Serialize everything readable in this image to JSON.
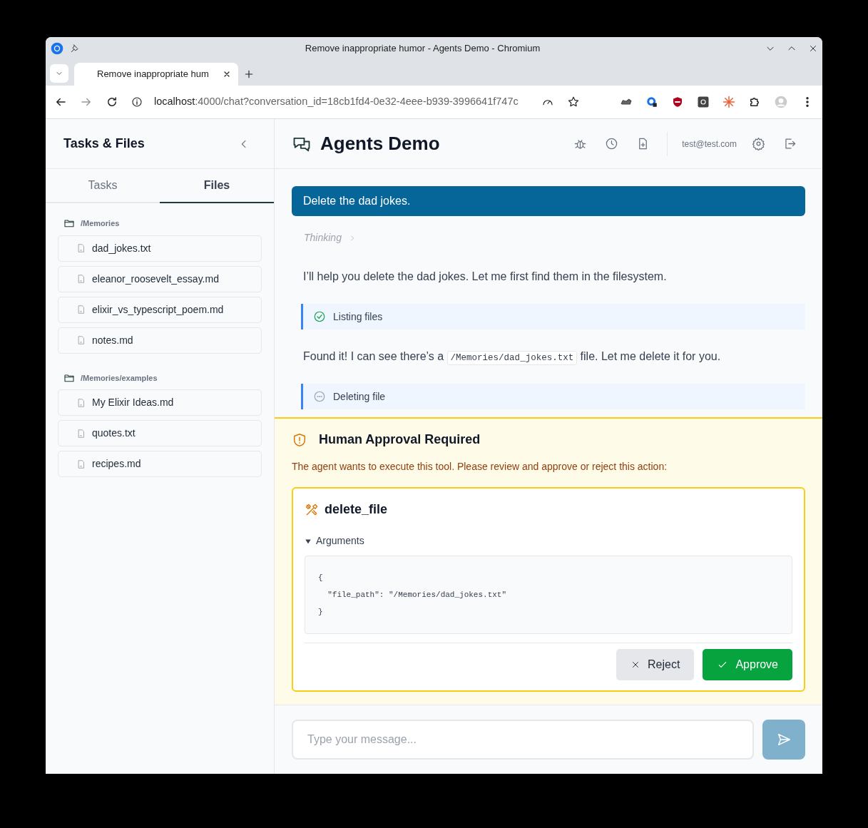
{
  "browser": {
    "window_title": "Remove inappropriate humor - Agents Demo - Chromium",
    "tab_title": "Remove inappropriate hum",
    "url_host": "localhost",
    "url_rest": ":4000/chat?conversation_id=18cb1fd4-0e32-4eee-b939-3996641f747c"
  },
  "sidebar": {
    "title": "Tasks & Files",
    "tabs": [
      {
        "label": "Tasks",
        "selected": false
      },
      {
        "label": "Files",
        "selected": true
      }
    ],
    "folders": [
      {
        "path": "/Memories",
        "files": [
          "dad_jokes.txt",
          "eleanor_roosevelt_essay.md",
          "elixir_vs_typescript_poem.md",
          "notes.md"
        ]
      },
      {
        "path": "/Memories/examples",
        "files": [
          "My Elixir Ideas.md",
          "quotes.txt",
          "recipes.md"
        ]
      }
    ]
  },
  "header": {
    "title": "Agents Demo",
    "user": "test@test.com"
  },
  "messages": [
    {
      "kind": "user",
      "text": "Delete the dad jokes."
    },
    {
      "kind": "thinking",
      "text": "Thinking"
    },
    {
      "kind": "assistant",
      "parts": [
        {
          "text": "I’ll help you delete the dad jokes. Let me first find them in the filesystem."
        }
      ]
    },
    {
      "kind": "tool",
      "text": "Listing files",
      "done": true
    },
    {
      "kind": "assistant",
      "parts": [
        {
          "text": "Found it! I can see there’s a "
        },
        {
          "code": "/Memories/dad_jokes.txt"
        },
        {
          "text": " file. Let me delete it for you."
        }
      ]
    },
    {
      "kind": "tool",
      "text": "Deleting file",
      "done": false
    }
  ],
  "approval": {
    "title": "Human Approval Required",
    "description": "The agent wants to execute this tool. Please review and approve or reject this action:",
    "tool": "delete_file",
    "arguments_label": "Arguments",
    "expanded": true,
    "arguments": [
      "{",
      "  \"file_path\": \"/Memories/dad_jokes.txt\"",
      "}"
    ],
    "buttons": [
      {
        "kind": "reject",
        "label": "Reject"
      },
      {
        "kind": "approve",
        "label": "Approve"
      }
    ]
  },
  "composer": {
    "placeholder": "Type your message..."
  }
}
